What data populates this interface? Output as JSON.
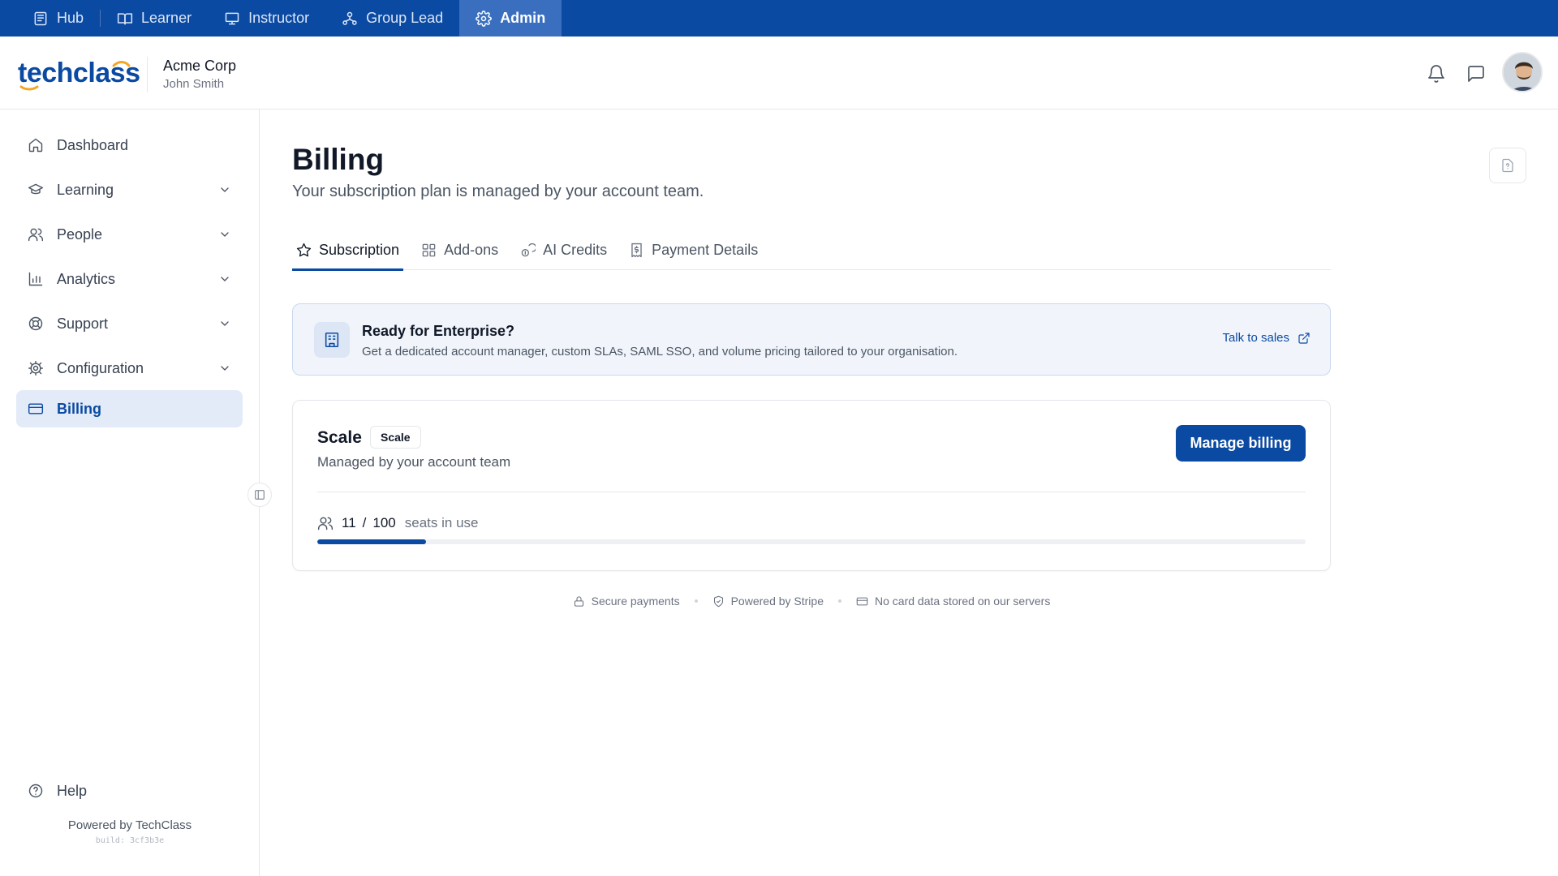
{
  "roles": [
    {
      "label": "Hub",
      "icon": "hub-icon",
      "active": false
    },
    {
      "label": "Learner",
      "icon": "book-icon",
      "active": false
    },
    {
      "label": "Instructor",
      "icon": "presentation-icon",
      "active": false
    },
    {
      "label": "Group Lead",
      "icon": "group-icon",
      "active": false
    },
    {
      "label": "Admin",
      "icon": "gear-icon",
      "active": true
    }
  ],
  "brand": {
    "logo_text": "techclass",
    "accent": "#0b4aa2",
    "logo_arc": "#f5a623"
  },
  "org": {
    "name": "Acme Corp",
    "user": "John Smith"
  },
  "sidebar": {
    "items": [
      {
        "label": "Dashboard",
        "icon": "home-icon",
        "expandable": false,
        "active": false
      },
      {
        "label": "Learning",
        "icon": "graduation-cap-icon",
        "expandable": true,
        "active": false
      },
      {
        "label": "People",
        "icon": "users-icon",
        "expandable": true,
        "active": false
      },
      {
        "label": "Analytics",
        "icon": "bar-chart-icon",
        "expandable": true,
        "active": false
      },
      {
        "label": "Support",
        "icon": "lifebuoy-icon",
        "expandable": true,
        "active": false
      },
      {
        "label": "Configuration",
        "icon": "gear-icon",
        "expandable": true,
        "active": false
      },
      {
        "label": "Billing",
        "icon": "credit-card-icon",
        "expandable": false,
        "active": true
      }
    ],
    "help_label": "Help",
    "powered_by": "Powered by TechClass",
    "build": "build: 3cf3b3e"
  },
  "page": {
    "title": "Billing",
    "subtitle": "Your subscription plan is managed by your account team."
  },
  "tabs": [
    {
      "label": "Subscription",
      "icon": "star-icon",
      "active": true
    },
    {
      "label": "Add-ons",
      "icon": "grid-icon",
      "active": false
    },
    {
      "label": "AI Credits",
      "icon": "coins-icon",
      "active": false
    },
    {
      "label": "Payment Details",
      "icon": "receipt-icon",
      "active": false
    }
  ],
  "banner": {
    "title": "Ready for Enterprise?",
    "text": "Get a dedicated account manager, custom SLAs, SAML SSO, and volume pricing tailored to your organisation.",
    "link": "Talk to sales"
  },
  "plan": {
    "name": "Scale",
    "badge": "Scale",
    "subtitle": "Managed by your account team",
    "button": "Manage billing",
    "seats_used": "11",
    "seats_sep": "/",
    "seats_total": "100",
    "seats_label": "seats in use",
    "seats_fraction": 0.11
  },
  "trust": [
    {
      "label": "Secure payments",
      "icon": "lock-icon"
    },
    {
      "label": "Powered by Stripe",
      "icon": "shield-icon"
    },
    {
      "label": "No card data stored on our servers",
      "icon": "credit-card-icon"
    }
  ]
}
